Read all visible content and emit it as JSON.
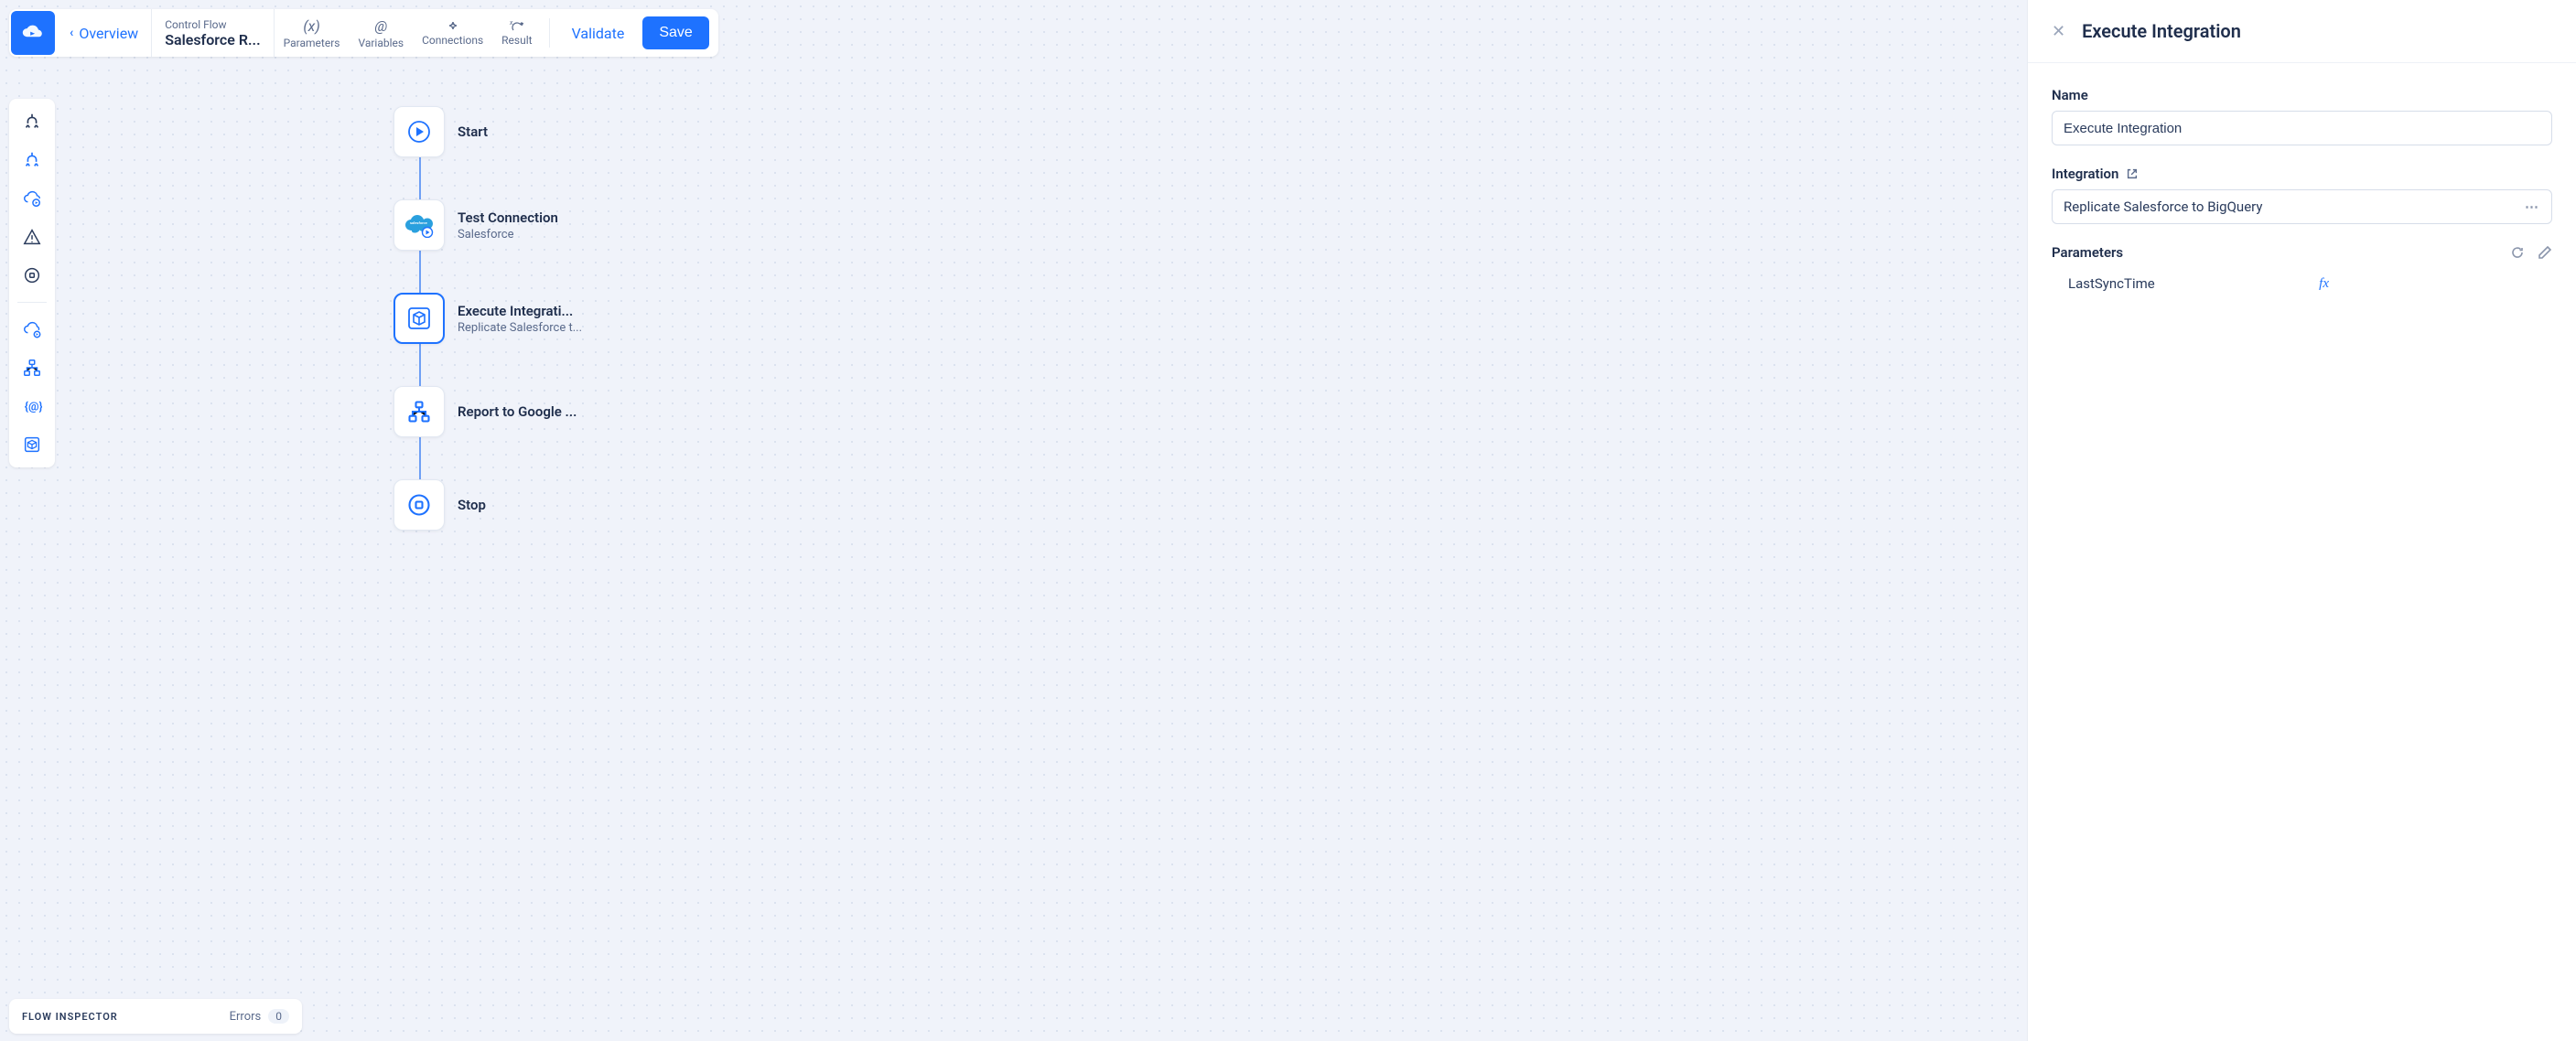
{
  "topbar": {
    "overview_label": "Overview",
    "breadcrumb_small": "Control Flow",
    "breadcrumb_big": "Salesforce R...",
    "tools": {
      "parameters": "Parameters",
      "variables": "Variables",
      "connections": "Connections",
      "result": "Result"
    },
    "validate_label": "Validate",
    "save_label": "Save"
  },
  "flow_nodes": {
    "start": {
      "title": "Start"
    },
    "test_conn": {
      "title": "Test Connection",
      "sub": "Salesforce"
    },
    "exec_integ": {
      "title": "Execute Integrati...",
      "sub": "Replicate Salesforce t..."
    },
    "report": {
      "title": "Report to Google ..."
    },
    "stop": {
      "title": "Stop"
    }
  },
  "flow_inspector": {
    "title": "FLOW INSPECTOR",
    "errors_label": "Errors",
    "errors_count": "0"
  },
  "right_panel": {
    "title": "Execute Integration",
    "name_label": "Name",
    "name_value": "Execute Integration",
    "integration_label": "Integration",
    "integration_value": "Replicate Salesforce to BigQuery",
    "parameters_label": "Parameters",
    "param_rows": {
      "p0": {
        "name": "LastSyncTime",
        "fx": "fx"
      }
    }
  }
}
